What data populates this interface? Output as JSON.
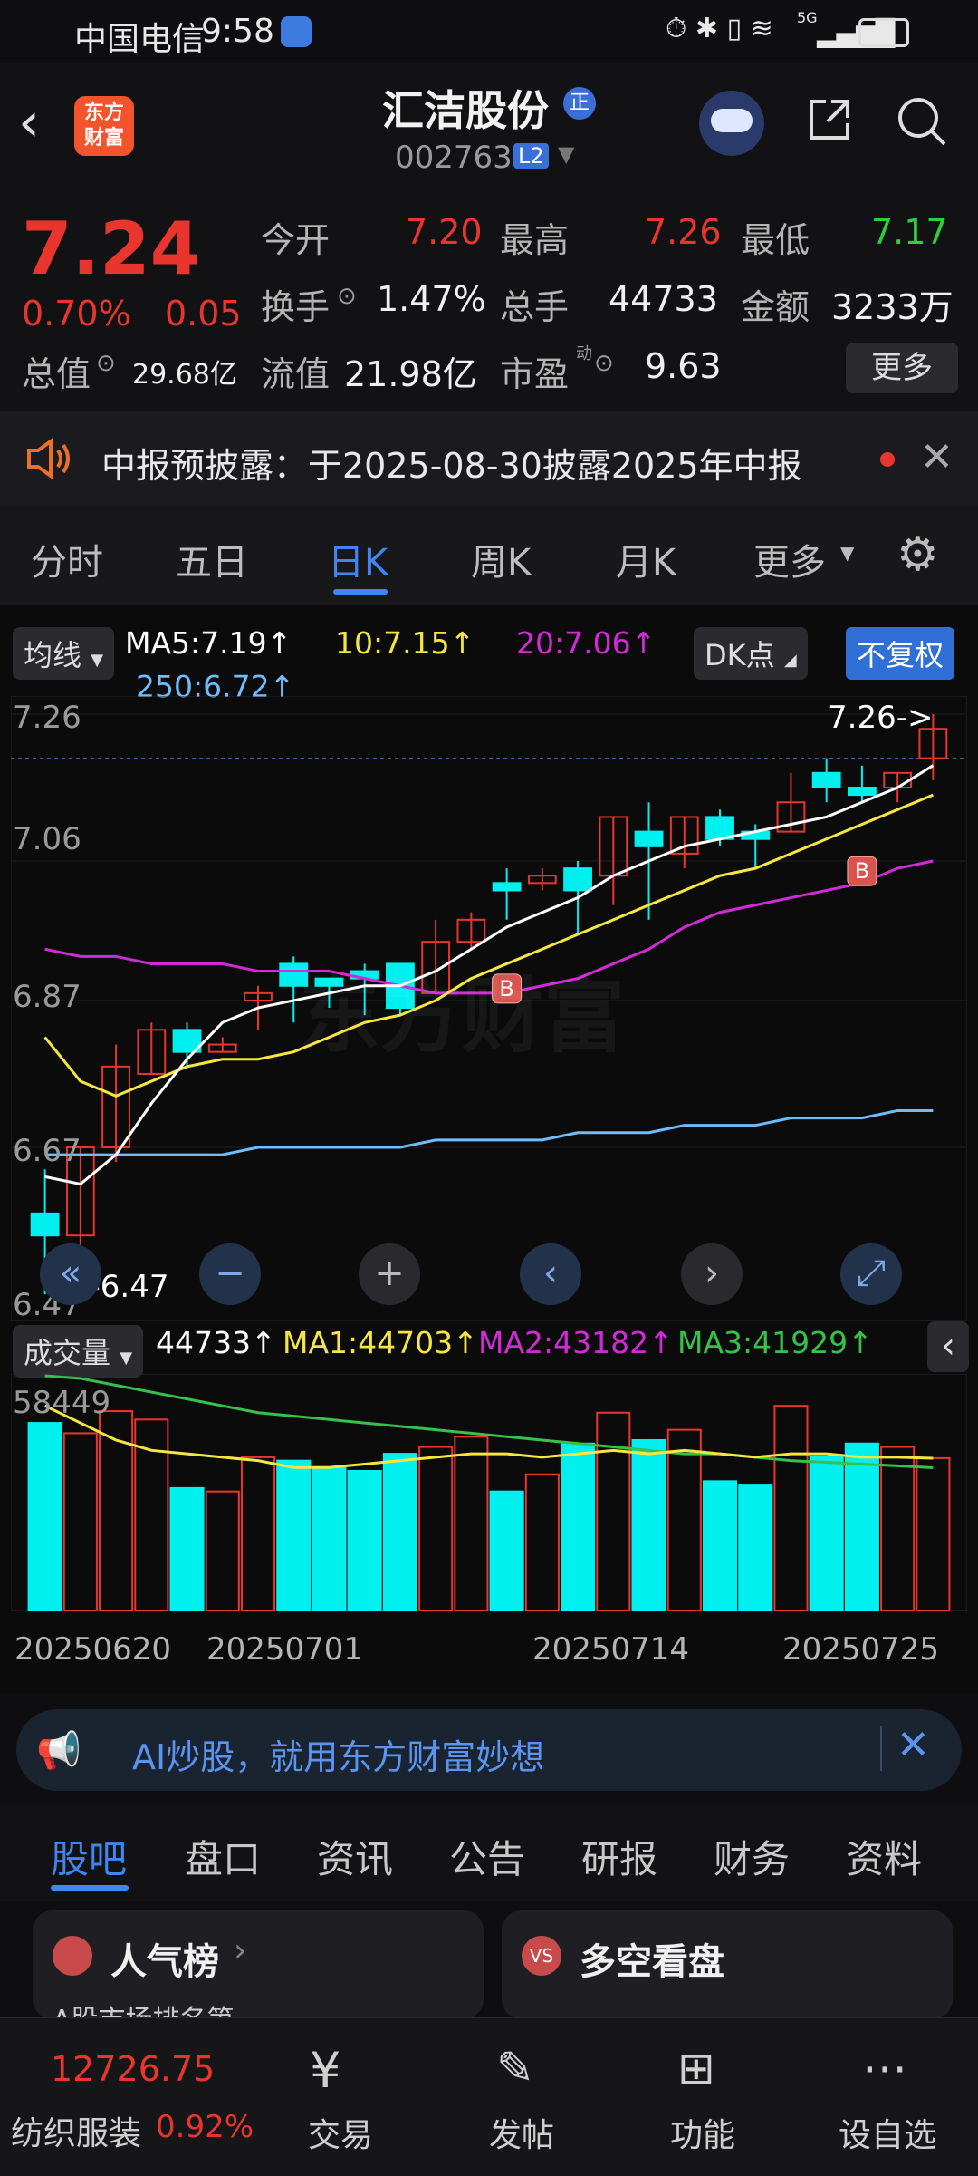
{
  "status": {
    "carrier": "中国电信",
    "time": "9:58",
    "network": "5G"
  },
  "header": {
    "logo_line1": "东方",
    "logo_line2": "财富",
    "stock_name": "汇洁股份",
    "badge": "正",
    "code": "002763",
    "level": "L2"
  },
  "quote": {
    "price": "7.24",
    "change_pct": "0.70%",
    "change": "0.05",
    "open_label": "今开",
    "open": "7.20",
    "high_label": "最高",
    "high": "7.26",
    "low_label": "最低",
    "low": "7.17",
    "turnover_label": "换手",
    "turnover": "1.47%",
    "volume_label": "总手",
    "volume": "44733",
    "amount_label": "金额",
    "amount": "3233万",
    "mktcap_label": "总值",
    "mktcap": "29.68亿",
    "float_label": "流值",
    "float": "21.98亿",
    "pe_label": "市盈",
    "pe_sup": "动",
    "pe": "9.63",
    "more": "更多"
  },
  "notice": {
    "text": "中报预披露：于2025-08-30披露2025年中报"
  },
  "tabs": [
    "分时",
    "五日",
    "日K",
    "周K",
    "月K",
    "更多"
  ],
  "active_tab": "日K",
  "chart": {
    "ma_selector": "均线",
    "ma5": "MA5:7.19↑",
    "ma10": "10:7.15↑",
    "ma20": "20:7.06↑",
    "ma250": "250:6.72↑",
    "dk_label": "DK点",
    "adjust_label": "不复权",
    "high_marker": "7.26->",
    "low_marker": "<-6.47",
    "y_labels": [
      "7.26",
      "7.06",
      "6.87",
      "6.67",
      "6.47"
    ],
    "watermark": "东方财富",
    "vol_selector": "成交量",
    "vol_value": "44733↑",
    "vol_ma1": "MA1:44703↑",
    "vol_ma2": "MA2:43182↑",
    "vol_ma3": "MA3:41929↑",
    "vol_max": "58449",
    "dates": [
      "20250620",
      "20250701",
      "20250714",
      "20250725"
    ],
    "colors": {
      "up": "#e8362f",
      "down": "#00f0f0",
      "ma5": "#ffffff",
      "ma10": "#f5e642",
      "ma20": "#d12bd6",
      "ma250": "#6fbcff",
      "vol_ma3": "#36c24a"
    }
  },
  "chart_data": {
    "type": "candlestick",
    "y_range": [
      6.47,
      7.26
    ],
    "candles": [
      {
        "o": 6.58,
        "c": 6.55,
        "h": 6.64,
        "l": 6.47
      },
      {
        "o": 6.55,
        "c": 6.67,
        "h": 6.67,
        "l": 6.52
      },
      {
        "o": 6.67,
        "c": 6.78,
        "h": 6.81,
        "l": 6.65
      },
      {
        "o": 6.77,
        "c": 6.83,
        "h": 6.84,
        "l": 6.77
      },
      {
        "o": 6.83,
        "c": 6.8,
        "h": 6.84,
        "l": 6.78
      },
      {
        "o": 6.8,
        "c": 6.81,
        "h": 6.82,
        "l": 6.8
      },
      {
        "o": 6.87,
        "c": 6.88,
        "h": 6.89,
        "l": 6.83
      },
      {
        "o": 6.92,
        "c": 6.89,
        "h": 6.93,
        "l": 6.84
      },
      {
        "o": 6.9,
        "c": 6.89,
        "h": 6.9,
        "l": 6.86
      },
      {
        "o": 6.91,
        "c": 6.9,
        "h": 6.92,
        "l": 6.85
      },
      {
        "o": 6.92,
        "c": 6.86,
        "h": 6.92,
        "l": 6.85
      },
      {
        "o": 6.88,
        "c": 6.95,
        "h": 6.98,
        "l": 6.88
      },
      {
        "o": 6.95,
        "c": 6.98,
        "h": 6.99,
        "l": 6.94
      },
      {
        "o": 7.03,
        "c": 7.02,
        "h": 7.05,
        "l": 6.98
      },
      {
        "o": 7.03,
        "c": 7.04,
        "h": 7.05,
        "l": 7.02
      },
      {
        "o": 7.05,
        "c": 7.02,
        "h": 7.06,
        "l": 6.96
      },
      {
        "o": 7.04,
        "c": 7.12,
        "h": 7.12,
        "l": 7.0
      },
      {
        "o": 7.1,
        "c": 7.08,
        "h": 7.14,
        "l": 6.98
      },
      {
        "o": 7.07,
        "c": 7.12,
        "h": 7.12,
        "l": 7.05
      },
      {
        "o": 7.12,
        "c": 7.09,
        "h": 7.13,
        "l": 7.08
      },
      {
        "o": 7.1,
        "c": 7.09,
        "h": 7.11,
        "l": 7.05
      },
      {
        "o": 7.1,
        "c": 7.14,
        "h": 7.18,
        "l": 7.1
      },
      {
        "o": 7.18,
        "c": 7.16,
        "h": 7.2,
        "l": 7.14
      },
      {
        "o": 7.16,
        "c": 7.15,
        "h": 7.19,
        "l": 7.14
      },
      {
        "o": 7.16,
        "c": 7.18,
        "h": 7.18,
        "l": 7.14
      },
      {
        "o": 7.2,
        "c": 7.24,
        "h": 7.26,
        "l": 7.17
      }
    ],
    "ma5": [
      6.63,
      6.62,
      6.66,
      6.73,
      6.79,
      6.84,
      6.86,
      6.87,
      6.88,
      6.89,
      6.89,
      6.91,
      6.94,
      6.97,
      6.99,
      7.01,
      7.04,
      7.06,
      7.08,
      7.09,
      7.1,
      7.11,
      7.12,
      7.14,
      7.16,
      7.19
    ],
    "ma10": [
      6.82,
      6.76,
      6.74,
      6.76,
      6.78,
      6.79,
      6.79,
      6.8,
      6.82,
      6.84,
      6.85,
      6.87,
      6.9,
      6.92,
      6.94,
      6.96,
      6.98,
      7.0,
      7.02,
      7.04,
      7.05,
      7.07,
      7.09,
      7.11,
      7.13,
      7.15
    ],
    "ma20": [
      6.94,
      6.93,
      6.93,
      6.92,
      6.92,
      6.92,
      6.91,
      6.91,
      6.91,
      6.9,
      6.89,
      6.88,
      6.88,
      6.88,
      6.89,
      6.9,
      6.92,
      6.94,
      6.97,
      6.99,
      7.0,
      7.01,
      7.02,
      7.03,
      7.05,
      7.06
    ],
    "ma250": [
      6.66,
      6.66,
      6.66,
      6.66,
      6.66,
      6.66,
      6.67,
      6.67,
      6.67,
      6.67,
      6.67,
      6.68,
      6.68,
      6.68,
      6.68,
      6.69,
      6.69,
      6.69,
      6.7,
      6.7,
      6.7,
      6.71,
      6.71,
      6.71,
      6.72,
      6.72
    ],
    "volume": [
      55000,
      52000,
      58449,
      56000,
      36000,
      35000,
      45000,
      44000,
      42000,
      41000,
      46000,
      48000,
      51000,
      35000,
      40000,
      49000,
      58000,
      50000,
      53000,
      38000,
      37000,
      60000,
      45000,
      49000,
      48000,
      44733
    ],
    "vol_ma1": [
      60000,
      55000,
      50000,
      47000,
      46000,
      45000,
      44000,
      42000,
      42000,
      43000,
      44000,
      45000,
      46000,
      46000,
      45000,
      46000,
      47000,
      46000,
      47000,
      46000,
      45000,
      46000,
      46000,
      45000,
      45000,
      44703
    ],
    "vol_ma3": [
      70000,
      68000,
      66000,
      64000,
      62000,
      60000,
      58000,
      57000,
      56000,
      55000,
      54000,
      53000,
      52000,
      51000,
      50000,
      49000,
      48000,
      47000,
      46000,
      46000,
      45000,
      44000,
      43500,
      43000,
      42500,
      41929
    ]
  },
  "ad": {
    "text": "AI炒股，就用东方财富妙想"
  },
  "bottom_tabs": [
    "股吧",
    "盘口",
    "资讯",
    "公告",
    "研报",
    "财务",
    "资料"
  ],
  "cards": [
    {
      "title": "人气榜",
      "sub": "A股市场排名第"
    },
    {
      "title": "多空看盘"
    }
  ],
  "bottom_nav": {
    "index_value": "12726.75",
    "index_name": "纺织服装",
    "index_change": "0.92%",
    "items": [
      "交易",
      "发帖",
      "功能",
      "设自选"
    ]
  }
}
